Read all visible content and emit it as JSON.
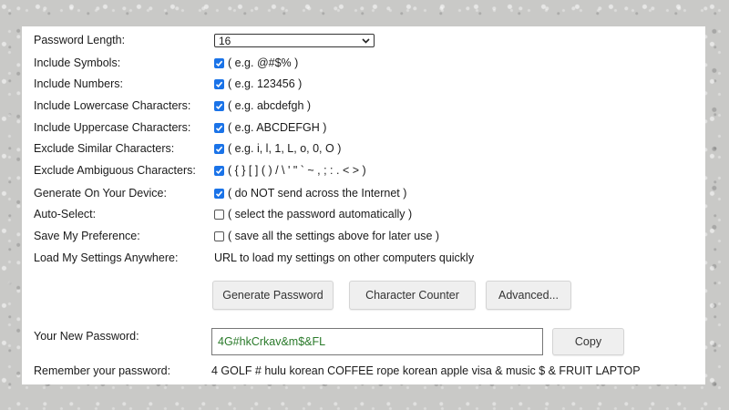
{
  "settings": {
    "length": {
      "label": "Password Length:",
      "value": "16"
    },
    "symbols": {
      "label": "Include Symbols:",
      "hint": "( e.g. @#$% )",
      "checked": true
    },
    "numbers": {
      "label": "Include Numbers:",
      "hint": "( e.g. 123456 )",
      "checked": true
    },
    "lowercase": {
      "label": "Include Lowercase Characters:",
      "hint": "( e.g. abcdefgh )",
      "checked": true
    },
    "uppercase": {
      "label": "Include Uppercase Characters:",
      "hint": "( e.g. ABCDEFGH )",
      "checked": true
    },
    "similar": {
      "label": "Exclude Similar Characters:",
      "hint": "( e.g. i, l, 1, L, o, 0, O )",
      "checked": true
    },
    "ambiguous": {
      "label": "Exclude Ambiguous Characters:",
      "hint": "( { } [ ] ( ) / \\ ' \" ` ~ , ; : . < > )",
      "checked": true
    },
    "on_device": {
      "label": "Generate On Your Device:",
      "hint": "( do NOT send across the Internet )",
      "checked": true
    },
    "auto_select": {
      "label": "Auto-Select:",
      "hint": "( select the password automatically )",
      "checked": false
    },
    "save_pref": {
      "label": "Save My Preference:",
      "hint": "( save all the settings above for later use )",
      "checked": false
    },
    "load_anywhere": {
      "label": "Load My Settings Anywhere:",
      "value": "URL to load my settings on other computers quickly"
    }
  },
  "buttons": {
    "generate": "Generate Password",
    "counter": "Character Counter",
    "advanced": "Advanced..."
  },
  "result": {
    "label": "Your New Password:",
    "password": "4G#hkCrkav&m$&FL",
    "copy": "Copy"
  },
  "mnemonic": {
    "label": "Remember your password:",
    "text": "4 GOLF # hulu korean COFFEE rope korean apple visa & music $ & FRUIT LAPTOP"
  },
  "colors": {
    "checkbox": "#1a73e8",
    "password_text": "#2a7a2a"
  }
}
